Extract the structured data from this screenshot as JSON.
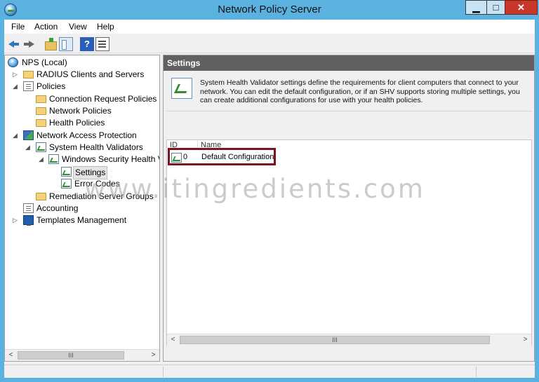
{
  "window": {
    "title": "Network Policy Server",
    "minimize": "▁",
    "maximize": "□",
    "close": "✕"
  },
  "menu": [
    "File",
    "Action",
    "View",
    "Help"
  ],
  "toolbar": {
    "help_label": "?"
  },
  "tree": [
    {
      "label": "NPS (Local)",
      "icon": "nps-icon",
      "expander": ""
    },
    {
      "label": "RADIUS Clients and Servers",
      "icon": "folder-icon",
      "expander": "▷"
    },
    {
      "label": "Policies",
      "icon": "policies-icon",
      "expander": "◢"
    },
    {
      "label": "Connection Request Policies",
      "icon": "folder-icon",
      "expander": ""
    },
    {
      "label": "Network Policies",
      "icon": "folder-icon",
      "expander": ""
    },
    {
      "label": "Health Policies",
      "icon": "folder-icon",
      "expander": ""
    },
    {
      "label": "Network Access Protection",
      "icon": "nap-icon",
      "expander": "◢"
    },
    {
      "label": "System Health Validators",
      "icon": "shv-icon",
      "expander": "◢"
    },
    {
      "label": "Windows Security Health V",
      "icon": "shv-icon",
      "expander": "◢"
    },
    {
      "label": "Settings",
      "icon": "shv-icon",
      "expander": ""
    },
    {
      "label": "Error Codes",
      "icon": "shv-icon",
      "expander": ""
    },
    {
      "label": "Remediation Server Groups",
      "icon": "folder-icon",
      "expander": ""
    },
    {
      "label": "Accounting",
      "icon": "accounting-icon",
      "expander": ""
    },
    {
      "label": "Templates Management",
      "icon": "templates-icon",
      "expander": "▷"
    }
  ],
  "right": {
    "header": "Settings",
    "description": "System Health Validator settings define the requirements for client computers that connect to your network. You can edit the default configuration, or if an SHV supports storing multiple settings, you can create additional configurations for use with your health policies.",
    "columns": {
      "id": "ID",
      "name": "Name"
    },
    "rows": [
      {
        "id": "0",
        "name": "Default Configuration"
      }
    ]
  },
  "scrollbar": {
    "left_arrow": "<",
    "right_arrow": ">",
    "grip": "III"
  },
  "watermark": "www.itingredients.com",
  "colors": {
    "titlebar": "#5bb2e0",
    "section_header": "#616161",
    "highlight_border": "#7a1420",
    "close_button": "#c7372c"
  }
}
